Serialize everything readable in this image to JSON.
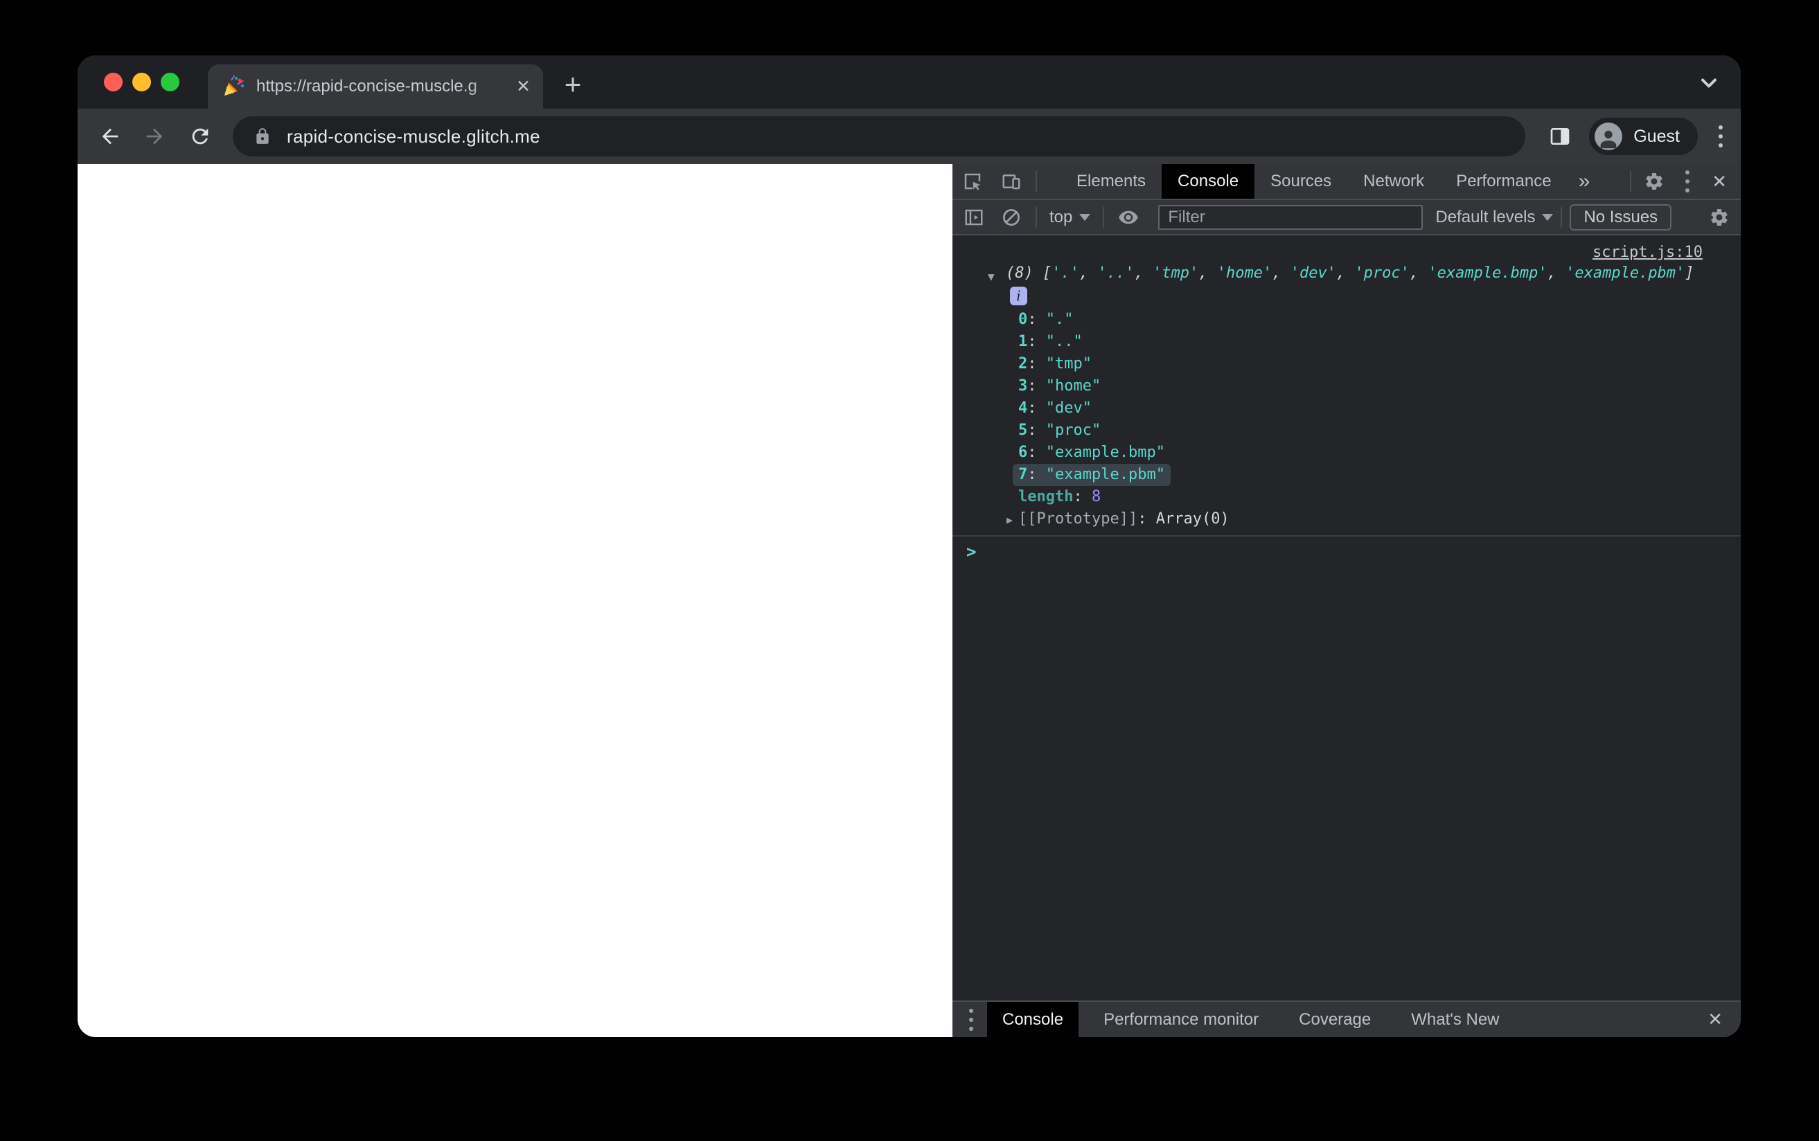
{
  "browser": {
    "traffic_lights": [
      "close",
      "minimize",
      "zoom"
    ],
    "tab": {
      "favicon_icon": "party-popper-icon",
      "title": "https://rapid-concise-muscle.g",
      "close_glyph": "✕"
    },
    "new_tab_glyph": "+",
    "url": "rapid-concise-muscle.glitch.me",
    "profile_label": "Guest"
  },
  "devtools": {
    "tabs": [
      "Elements",
      "Console",
      "Sources",
      "Network",
      "Performance"
    ],
    "active_tab": "Console",
    "more_tabs_glyph": "»",
    "close_glyph": "✕",
    "toolbar": {
      "context_selector": "top",
      "filter_placeholder": "Filter",
      "log_levels": "Default levels",
      "issues_label": "No Issues"
    },
    "console": {
      "source_link": "script.js:10",
      "array_count": "(8)",
      "bracket_open": "[",
      "bracket_close": "]",
      "item_separator": ", ",
      "preview_quote": "'",
      "entry_quote": "\"",
      "values": [
        ".",
        "..",
        "tmp",
        "home",
        "dev",
        "proc",
        "example.bmp",
        "example.pbm"
      ],
      "highlighted_index": 7,
      "info_badge": "i",
      "expand_triangle": "▼",
      "collapse_triangle": "▶",
      "colon_separator": ": ",
      "length_key": "length",
      "length_value": "8",
      "prototype_key": "[[Prototype]]",
      "prototype_value": "Array(0)",
      "prompt_glyph": ">"
    },
    "drawer": {
      "tabs": [
        "Console",
        "Performance monitor",
        "Coverage",
        "What's New"
      ],
      "active_tab": "Console",
      "close_glyph": "✕"
    }
  },
  "colors": {
    "string_teal": "#5dd5cc",
    "number_purple": "#9d8cf2",
    "muted_teal": "#4da8a2",
    "row_highlight_bg": "#39434a",
    "info_badge_bg": "#aeb3f0",
    "traffic_red": "#ff5f57",
    "traffic_yellow": "#febc2e",
    "traffic_green": "#28c840",
    "active_tab_bg": "#000000",
    "devtools_chrome_bg": "#333539",
    "console_bg": "#242528",
    "browser_chrome_bg": "#36373b",
    "tab_strip_bg": "#1e2023",
    "page_bg": "#ffffff"
  }
}
